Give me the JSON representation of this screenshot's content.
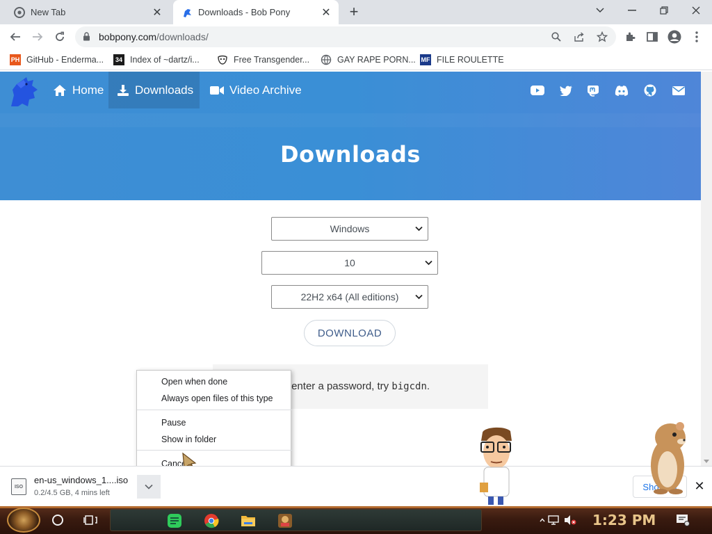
{
  "browser": {
    "tabs": [
      {
        "title": "New Tab",
        "icon": "chrome-icon"
      },
      {
        "title": "Downloads - Bob Pony",
        "icon": "bobpony-icon"
      }
    ],
    "url_host": "bobpony.com",
    "url_path": "/downloads/"
  },
  "bookmarks": [
    {
      "label": "GitHub - Enderma...",
      "icon": "PH",
      "color": "#e8581c"
    },
    {
      "label": "Index of ~dartz/i...",
      "icon": "34",
      "color": "#1b1b1b"
    },
    {
      "label": "Free Transgender...",
      "icon": "mask",
      "color": "#555555"
    },
    {
      "label": "GAY RAPE PORN...",
      "icon": "globe",
      "color": "#5f6368"
    },
    {
      "label": "FILE ROULETTE",
      "icon": "MF",
      "color": "#1a3a8a"
    }
  ],
  "site": {
    "nav": {
      "home": "Home",
      "downloads": "Downloads",
      "video_archive": "Video Archive"
    },
    "hero_title": "Downloads",
    "selects": {
      "os": "Windows",
      "version": "10",
      "build": "22H2 x64 (All editions)"
    },
    "download_button": "DOWNLOAD",
    "note_before": "d to enter a password, try ",
    "note_code": "bigcdn",
    "note_after": "."
  },
  "context_menu": {
    "open_when_done": "Open when done",
    "always_open": "Always open files of this type",
    "pause": "Pause",
    "show_in_folder": "Show in folder",
    "cancel": "Cancel"
  },
  "download_shelf": {
    "filename": "en-us_windows_1....iso",
    "file_type": "ISO",
    "status": "0.2/4.5 GB, 4 mins left",
    "show_all": "Show all"
  },
  "taskbar": {
    "clock": "1:23 PM"
  },
  "colors": {
    "hero_start": "#3e8ed4",
    "hero_end": "#4f86d8",
    "accent_blue": "#1a73e8"
  }
}
